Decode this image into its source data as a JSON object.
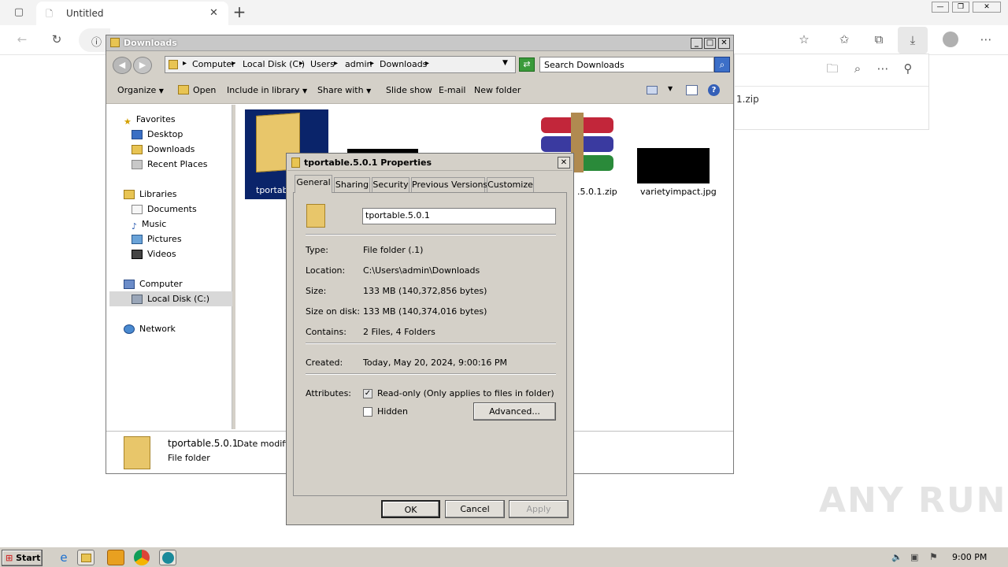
{
  "browser": {
    "tab_title": "Untitled",
    "download_item": "1.zip"
  },
  "explorer": {
    "title": "Downloads",
    "breadcrumb": [
      "Computer",
      "Local Disk (C:)",
      "Users",
      "admin",
      "Downloads"
    ],
    "search_placeholder": "Search Downloads",
    "commands": {
      "organize": "Organize",
      "open": "Open",
      "include": "Include in library",
      "share": "Share with",
      "slideshow": "Slide show",
      "email": "E-mail",
      "new_folder": "New folder"
    },
    "nav": {
      "favorites": "Favorites",
      "desktop": "Desktop",
      "downloads": "Downloads",
      "recent": "Recent Places",
      "libraries": "Libraries",
      "documents": "Documents",
      "music": "Music",
      "pictures": "Pictures",
      "videos": "Videos",
      "computer": "Computer",
      "local_disk": "Local Disk (C:)",
      "network": "Network"
    },
    "files": {
      "folder": "tportab",
      "zip": ".5.0.1.zip",
      "jpg": "varietyimpact.jpg"
    },
    "details": {
      "name": "tportable.5.0.1",
      "date_label": "Date modifie",
      "type": "File folder"
    }
  },
  "properties": {
    "title": "tportable.5.0.1 Properties",
    "tabs": [
      "General",
      "Sharing",
      "Security",
      "Previous Versions",
      "Customize"
    ],
    "name_value": "tportable.5.0.1",
    "type_label": "Type:",
    "type_value": "File folder (.1)",
    "location_label": "Location:",
    "location_value": "C:\\Users\\admin\\Downloads",
    "size_label": "Size:",
    "size_value": "133 MB (140,372,856 bytes)",
    "size_disk_label": "Size on disk:",
    "size_disk_value": "133 MB (140,374,016 bytes)",
    "contains_label": "Contains:",
    "contains_value": "2 Files, 4 Folders",
    "created_label": "Created:",
    "created_value": "Today, May 20, 2024, 9:00:16 PM",
    "attributes_label": "Attributes:",
    "readonly_label": "Read-only (Only applies to files in folder)",
    "hidden_label": "Hidden",
    "advanced_label": "Advanced...",
    "ok_label": "OK",
    "cancel_label": "Cancel",
    "apply_label": "Apply"
  },
  "taskbar": {
    "start_label": "Start",
    "clock": "9:00 PM"
  },
  "watermark": "ANY RUN"
}
